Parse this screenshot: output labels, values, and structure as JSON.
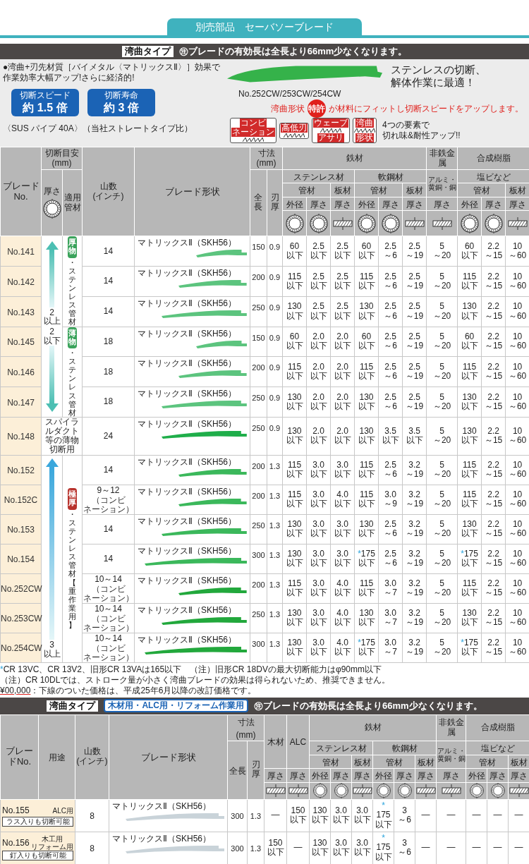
{
  "section_tab": "別売部品　セーバソーブレード",
  "banner": {
    "type_label": "湾曲タイプ",
    "note": "㊟ブレードの有効長は全長より66mm少なくなります。"
  },
  "intro": {
    "bullet_lines": [
      "●湾曲+刃先材質［バイメタル〈マトリックスⅡ〉］効果で",
      "作業効率大幅アップ!さらに経済的!"
    ],
    "badges": [
      {
        "title": "切断スピード",
        "value": "約 1.5 倍"
      },
      {
        "title": "切断寿命",
        "value": "約 3 倍"
      }
    ],
    "comparison": "〈SUS パイプ 40A〉（当社ストレートタイプ比）",
    "blade_caption": "No.252CW/253CW/254CW",
    "headline": [
      "ステンレスの切断、",
      "解体作業に最適！"
    ],
    "callout": {
      "before": "湾曲形状",
      "badge": "特許",
      "after": "が材料にフィットし切断スピードをアップします。"
    },
    "features": [
      {
        "top": [
          "コンビ",
          "ネーション"
        ]
      },
      {
        "top": [
          "高低刃"
        ]
      },
      {
        "top": [
          "ウェーブ"
        ],
        "bottom": "アサリ"
      },
      {
        "top": [
          "湾曲"
        ],
        "bottom": "形状"
      }
    ],
    "features_text": [
      "4つの要素で",
      "切れ味&耐性アップ!!"
    ]
  },
  "table1": {
    "header": {
      "blade_no": [
        "ブレード",
        "No."
      ],
      "guide": [
        "切断目安",
        "(mm)"
      ],
      "guide_thickness": "厚さ",
      "guide_pipe": [
        "適用",
        "管材"
      ],
      "teeth": [
        "山数",
        "(インチ)"
      ],
      "shape": "ブレード形状",
      "size": [
        "寸法",
        "(mm)"
      ],
      "length": "全長",
      "blade_thickness": "刃厚",
      "materials": [
        {
          "label": "鉄材",
          "subs": [
            {
              "label": "ステンレス材",
              "forms": [
                {
                  "label": "管材",
                  "measures": [
                    {
                      "label": "外径",
                      "kind": "pipe"
                    },
                    {
                      "label": "厚さ",
                      "kind": "pipe"
                    }
                  ]
                },
                {
                  "label": "板材",
                  "measures": [
                    {
                      "label": "厚さ",
                      "kind": "plate"
                    }
                  ]
                }
              ]
            },
            {
              "label": "軟鋼材",
              "forms": [
                {
                  "label": "管材",
                  "measures": [
                    {
                      "label": "外径",
                      "kind": "pipe"
                    },
                    {
                      "label": "厚さ",
                      "kind": "pipe"
                    }
                  ]
                },
                {
                  "label": "板材",
                  "measures": [
                    {
                      "label": "厚さ",
                      "kind": "plate"
                    }
                  ]
                }
              ]
            }
          ]
        },
        {
          "label": "非鉄金属",
          "subs": [
            {
              "label": "アルミ・黄銅・銅",
              "forms": [
                {
                  "measures": [
                    {
                      "label": "厚さ",
                      "kind": "plate"
                    }
                  ]
                }
              ]
            }
          ]
        },
        {
          "label": "合成樹脂",
          "subs": [
            {
              "label": "塩ビなど",
              "forms": [
                {
                  "label": "管材",
                  "measures": [
                    {
                      "label": "外径",
                      "kind": "pipe"
                    },
                    {
                      "label": "厚さ",
                      "kind": "pipe"
                    }
                  ]
                },
                {
                  "label": "板材",
                  "measures": [
                    {
                      "label": "厚さ",
                      "kind": "plate"
                    }
                  ]
                }
              ]
            }
          ]
        }
      ]
    },
    "bands": [
      {
        "kind": "range",
        "down_arrow": true,
        "labels": [
          "2\n以上",
          "2\n以下"
        ],
        "pipe_groups": [
          {
            "badge": "厚物",
            "color": "#3aa35b",
            "text": "・ステンレス管材",
            "rows": [
              {
                "no": "No.141",
                "teeth": "14",
                "material": "マトリックスⅡ（SKH56）",
                "color": "#5cc47e",
                "length": "150",
                "thickness": "0.9",
                "cells": [
                  "60\n以下",
                  "2.5\n以下",
                  "2.5\n以下",
                  "60\n以下",
                  "2.5\n～6",
                  "2.5\n～19",
                  "5\n～20",
                  "60\n以下",
                  "2.2\n～15",
                  "10\n～60"
                ]
              },
              {
                "no": "No.142",
                "teeth": "14",
                "material": "マトリックスⅡ（SKH56）",
                "color": "#5cc47e",
                "length": "200",
                "thickness": "0.9",
                "cells": [
                  "115\n以下",
                  "2.5\n以下",
                  "2.5\n以下",
                  "115\n以下",
                  "2.5\n～6",
                  "2.5\n～19",
                  "5\n～20",
                  "115\n以下",
                  "2.2\n～15",
                  "10\n～60"
                ]
              },
              {
                "no": "No.143",
                "teeth": "14",
                "material": "マトリックスⅡ（SKH56）",
                "color": "#5cc47e",
                "length": "250",
                "thickness": "0.9",
                "cells": [
                  "130\n以下",
                  "2.5\n以下",
                  "2.5\n以下",
                  "130\n以下",
                  "2.5\n～6",
                  "2.5\n～19",
                  "5\n～20",
                  "130\n以下",
                  "2.2\n～15",
                  "10\n～60"
                ]
              }
            ]
          },
          {
            "badge": "薄物",
            "color": "#3aa35b",
            "text": "・ステンレス管材",
            "rows": [
              {
                "no": "No.145",
                "teeth": "18",
                "material": "マトリックスⅡ（SKH56）",
                "color": "#5cc47e",
                "length": "150",
                "thickness": "0.9",
                "cells": [
                  "60\n以下",
                  "2.0\n以下",
                  "2.0\n以下",
                  "60\n以下",
                  "2.5\n～6",
                  "2.5\n～19",
                  "5\n～20",
                  "60\n以下",
                  "2.2\n～15",
                  "10\n～60"
                ]
              },
              {
                "no": "No.146",
                "teeth": "18",
                "material": "マトリックスⅡ（SKH56）",
                "color": "#5cc47e",
                "length": "200",
                "thickness": "0.9",
                "cells": [
                  "115\n以下",
                  "2.0\n以下",
                  "2.0\n以下",
                  "115\n以下",
                  "2.5\n～6",
                  "2.5\n～19",
                  "5\n～20",
                  "115\n以下",
                  "2.2\n～15",
                  "10\n～60"
                ]
              },
              {
                "no": "No.147",
                "teeth": "18",
                "material": "マトリックスⅡ（SKH56）",
                "color": "#5cc47e",
                "length": "250",
                "thickness": "0.9",
                "cells": [
                  "130\n以下",
                  "2.0\n以下",
                  "2.0\n以下",
                  "130\n以下",
                  "2.5\n～6",
                  "2.5\n～19",
                  "5\n～20",
                  "130\n以下",
                  "2.2\n～15",
                  "10\n～60"
                ]
              }
            ]
          }
        ]
      },
      {
        "kind": "note",
        "text": "スパイラルダクト等の薄物切断用",
        "rows": [
          {
            "no": "No.148",
            "teeth": "24",
            "material": "マトリックスⅡ（SKH56）",
            "color": "#1fae4a",
            "length": "250",
            "thickness": "0.9",
            "cells": [
              "130\n以下",
              "2.0\n以下",
              "2.0\n以下",
              "130\n以下",
              "3.5\n以下",
              "3.5\n以下",
              "5\n～20",
              "130\n以下",
              "2.2\n～15",
              "10\n～60"
            ]
          }
        ]
      },
      {
        "kind": "range",
        "down_arrow": false,
        "labels": [
          "3\n以上"
        ],
        "pipe_groups": [
          {
            "badge": "極厚",
            "color": "#b8322c",
            "text": "・ステンレス管材【重作業用】",
            "rows": [
              {
                "no": "No.152",
                "teeth": "14",
                "material": "マトリックスⅡ（SKH56）",
                "color": "#3bb85b",
                "length": "200",
                "thickness": "1.3",
                "cells": [
                  "115\n以下",
                  "3.0\n以下",
                  "3.0\n以下",
                  "115\n以下",
                  "2.5\n～6",
                  "3.2\n～19",
                  "5\n～20",
                  "115\n以下",
                  "2.2\n～15",
                  "10\n～60"
                ]
              },
              {
                "no": "No.152C",
                "teeth": "9～12",
                "teeth_note": [
                  "（コンビ",
                  "ネーション）"
                ],
                "material": "マトリックスⅡ（SKH56）",
                "color": "#3bb85b",
                "length": "200",
                "thickness": "1.3",
                "cells": [
                  "115\n以下",
                  "3.0\n以下",
                  "4.0\n以下",
                  "115\n以下",
                  "3.0\n～9",
                  "3.2\n～19",
                  "5\n～20",
                  "115\n以下",
                  "2.2\n～15",
                  "10\n～60"
                ]
              },
              {
                "no": "No.153",
                "teeth": "14",
                "material": "マトリックスⅡ（SKH56）",
                "color": "#3bb85b",
                "length": "250",
                "thickness": "1.3",
                "cells": [
                  "130\n以下",
                  "3.0\n以下",
                  "3.0\n以下",
                  "130\n以下",
                  "2.5\n～6",
                  "3.2\n～19",
                  "5\n～20",
                  "130\n以下",
                  "2.2\n～15",
                  "10\n～60"
                ]
              },
              {
                "no": "No.154",
                "teeth": "14",
                "material": "マトリックスⅡ（SKH56）",
                "color": "#3bb85b",
                "length": "300",
                "thickness": "1.3",
                "cells": [
                  "130\n以下",
                  "3.0\n以下",
                  "3.0\n以下",
                  {
                    "mark": "*",
                    "text": "175\n以下"
                  },
                  "2.5\n～6",
                  "3.2\n～19",
                  "5\n～20",
                  {
                    "mark": "*",
                    "text": "175\n以下"
                  },
                  "2.2\n～15",
                  "10\n～60"
                ]
              },
              {
                "no": "No.252CW",
                "teeth": "10～14",
                "teeth_note": [
                  "（コンビ",
                  "ネーション）"
                ],
                "material": "マトリックスⅡ（SKH56）",
                "color": "#22a83c",
                "length": "200",
                "thickness": "1.3",
                "cells": [
                  "115\n以下",
                  "3.0\n以下",
                  "4.0\n以下",
                  "115\n以下",
                  "3.0\n～7",
                  "3.2\n～19",
                  "5\n～20",
                  "115\n以下",
                  "2.2\n～15",
                  "10\n～60"
                ]
              },
              {
                "no": "No.253CW",
                "teeth": "10～14",
                "teeth_note": [
                  "（コンビ",
                  "ネーション）"
                ],
                "material": "マトリックスⅡ（SKH56）",
                "color": "#22a83c",
                "length": "250",
                "thickness": "1.3",
                "cells": [
                  "130\n以下",
                  "3.0\n以下",
                  "4.0\n以下",
                  "130\n以下",
                  "3.0\n～7",
                  "3.2\n～19",
                  "5\n～20",
                  "130\n以下",
                  "2.2\n～15",
                  "10\n～60"
                ]
              },
              {
                "no": "No.254CW",
                "teeth": "10～14",
                "teeth_note": [
                  "（コンビ",
                  "ネーション）"
                ],
                "material": "マトリックスⅡ（SKH56）",
                "color": "#22a83c",
                "length": "300",
                "thickness": "1.3",
                "cells": [
                  "130\n以下",
                  "3.0\n以下",
                  "4.0\n以下",
                  {
                    "mark": "*",
                    "text": "175\n以下"
                  },
                  "3.0\n～7",
                  "3.2\n～19",
                  "5\n～20",
                  {
                    "mark": "*",
                    "text": "175\n以下"
                  },
                  "2.2\n～15",
                  "10\n～60"
                ]
              }
            ]
          }
        ]
      }
    ]
  },
  "footnotes": [
    {
      "mark": "*",
      "text": "CR 13VC、CR 13V2、旧形CR 13VAは165以下　（注）旧形CR 18DVの最大切断能力はφ90mm以下"
    },
    {
      "text": "（注）CR 10DLでは、ストローク量が小さく湾曲ブレードの効果は得られないため、推奨できません。"
    },
    {
      "underlined": "¥00,000",
      "text": "：下線のついた価格は、平成25年6月以降の改訂価格です。"
    }
  ],
  "banner2": {
    "type_label": "湾曲タイプ",
    "use_label": "木材用・ALC用・リフォーム作業用",
    "note": "㊟ブレードの有効長は全長より66mm少なくなります。"
  },
  "table2": {
    "header": {
      "blade_no": "ブレードNo.",
      "use": "用途",
      "teeth": [
        "山数",
        "(インチ)"
      ],
      "shape": "ブレード形状",
      "size": "寸法(mm)",
      "length": "全長",
      "blade_thickness": "刃厚",
      "extras": [
        {
          "label": "木材",
          "measures": [
            {
              "label": "厚さ",
              "kind": "plate"
            }
          ]
        },
        {
          "label": "ALC",
          "measures": [
            {
              "label": "厚さ",
              "kind": "plate"
            }
          ]
        }
      ],
      "materials": [
        {
          "label": "鉄材",
          "subs": [
            {
              "label": "ステンレス材",
              "forms": [
                {
                  "label": "管材",
                  "measures": [
                    {
                      "label": "外径",
                      "kind": "pipe"
                    },
                    {
                      "label": "厚さ",
                      "kind": "pipe"
                    }
                  ]
                },
                {
                  "label": "板材",
                  "measures": [
                    {
                      "label": "厚さ",
                      "kind": "plate"
                    }
                  ]
                }
              ]
            },
            {
              "label": "軟鋼材",
              "forms": [
                {
                  "label": "管材",
                  "measures": [
                    {
                      "label": "外径",
                      "kind": "pipe"
                    },
                    {
                      "label": "厚さ",
                      "kind": "pipe"
                    }
                  ]
                },
                {
                  "label": "板材",
                  "measures": [
                    {
                      "label": "厚さ",
                      "kind": "plate"
                    }
                  ]
                }
              ]
            }
          ]
        },
        {
          "label": "非鉄金属",
          "subs": [
            {
              "label": "アルミ・黄銅・銅",
              "forms": [
                {
                  "measures": [
                    {
                      "label": "厚さ",
                      "kind": "plate"
                    }
                  ]
                }
              ]
            }
          ]
        },
        {
          "label": "合成樹脂",
          "subs": [
            {
              "label": "塩ビなど",
              "forms": [
                {
                  "label": "管材",
                  "measures": [
                    {
                      "label": "外径",
                      "kind": "pipe"
                    },
                    {
                      "label": "厚さ",
                      "kind": "pipe"
                    }
                  ]
                },
                {
                  "label": "板材",
                  "measures": [
                    {
                      "label": "厚さ",
                      "kind": "plate"
                    }
                  ]
                }
              ]
            }
          ]
        }
      ]
    },
    "rows": [
      {
        "no": "No.155",
        "use": [
          "ALC用"
        ],
        "note": "ラス入りも切断可能",
        "teeth": "8",
        "material": "マトリックスⅡ（SKH56）",
        "color": "#c9d3d9",
        "length": "300",
        "thickness": "1.3",
        "cells": [
          "—",
          "150\n以下",
          "130\n以下",
          "3.0\n以下",
          "3.0\n以下",
          {
            "mark": "*",
            "text": "175\n以下"
          },
          "3\n～6",
          "—",
          "—",
          "—",
          "—",
          "—"
        ]
      },
      {
        "no": "No.156",
        "use": [
          "木工用",
          "リフォーム用"
        ],
        "note": "釘入りも切断可能",
        "teeth": "8",
        "material": "マトリックスⅡ（SKH56）",
        "color": "#c9d3d9",
        "length": "300",
        "thickness": "1.3",
        "cells": [
          "150\n以下",
          "—",
          "130\n以下",
          "3.0\n以下",
          "3.0\n以下",
          {
            "mark": "*",
            "text": "175\n以下"
          },
          "3\n～6",
          "—",
          "—",
          "—",
          "—",
          "—"
        ]
      }
    ]
  }
}
